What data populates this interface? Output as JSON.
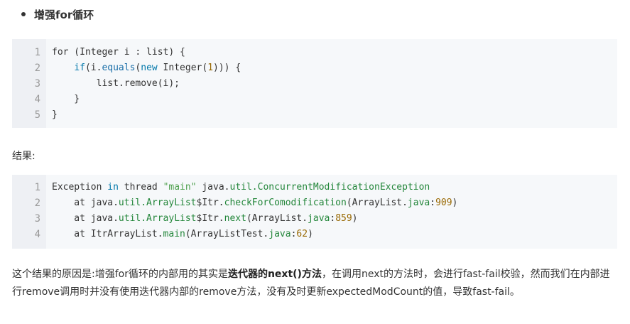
{
  "heading": "增强for循环",
  "code1": {
    "line_numbers": [
      "1",
      "2",
      "3",
      "4",
      "5"
    ],
    "lines": [
      [
        {
          "t": "for (Integer i : list) {",
          "c": ""
        }
      ],
      [
        {
          "t": "    ",
          "c": ""
        },
        {
          "t": "if",
          "c": "kw"
        },
        {
          "t": "(i.",
          "c": ""
        },
        {
          "t": "equals",
          "c": "fn"
        },
        {
          "t": "(",
          "c": ""
        },
        {
          "t": "new",
          "c": "kw"
        },
        {
          "t": " Integer(",
          "c": ""
        },
        {
          "t": "1",
          "c": "num"
        },
        {
          "t": "))) {",
          "c": ""
        }
      ],
      [
        {
          "t": "        list.remove(i);",
          "c": ""
        }
      ],
      [
        {
          "t": "    }",
          "c": ""
        }
      ],
      [
        {
          "t": "}",
          "c": ""
        }
      ]
    ]
  },
  "result_label": "结果:",
  "code2": {
    "line_numbers": [
      "1",
      "2",
      "3",
      "4"
    ],
    "lines": [
      [
        {
          "t": "Exception ",
          "c": ""
        },
        {
          "t": "in",
          "c": "kw"
        },
        {
          "t": " thread ",
          "c": ""
        },
        {
          "t": "\"main\"",
          "c": "str"
        },
        {
          "t": " java.",
          "c": ""
        },
        {
          "t": "util.ConcurrentModificationException",
          "c": "cls"
        }
      ],
      [
        {
          "t": "    at java.",
          "c": ""
        },
        {
          "t": "util.ArrayList",
          "c": "cls"
        },
        {
          "t": "$Itr.",
          "c": ""
        },
        {
          "t": "checkForComodification",
          "c": "cls"
        },
        {
          "t": "(ArrayList.",
          "c": ""
        },
        {
          "t": "java",
          "c": "cls"
        },
        {
          "t": ":",
          "c": ""
        },
        {
          "t": "909",
          "c": "num"
        },
        {
          "t": ")",
          "c": ""
        }
      ],
      [
        {
          "t": "    at java.",
          "c": ""
        },
        {
          "t": "util.ArrayList",
          "c": "cls"
        },
        {
          "t": "$Itr.",
          "c": ""
        },
        {
          "t": "next",
          "c": "cls"
        },
        {
          "t": "(ArrayList.",
          "c": ""
        },
        {
          "t": "java",
          "c": "cls"
        },
        {
          "t": ":",
          "c": ""
        },
        {
          "t": "859",
          "c": "num"
        },
        {
          "t": ")",
          "c": ""
        }
      ],
      [
        {
          "t": "    at ItrArrayList.",
          "c": ""
        },
        {
          "t": "main",
          "c": "cls"
        },
        {
          "t": "(ArrayListTest.",
          "c": ""
        },
        {
          "t": "java",
          "c": "cls"
        },
        {
          "t": ":",
          "c": ""
        },
        {
          "t": "62",
          "c": "num"
        },
        {
          "t": ")",
          "c": ""
        }
      ]
    ]
  },
  "explanation": {
    "part1": "这个结果的原因是:增强for循环的内部用的其实是",
    "bold": "迭代器的next()方法",
    "part2": "，在调用next的方法时，会进行fast-fail校验，然而我们在内部进行remove调用时并没有使用迭代器内部的remove方法，没有及时更新expectedModCount的值，导致fast-fail。"
  }
}
